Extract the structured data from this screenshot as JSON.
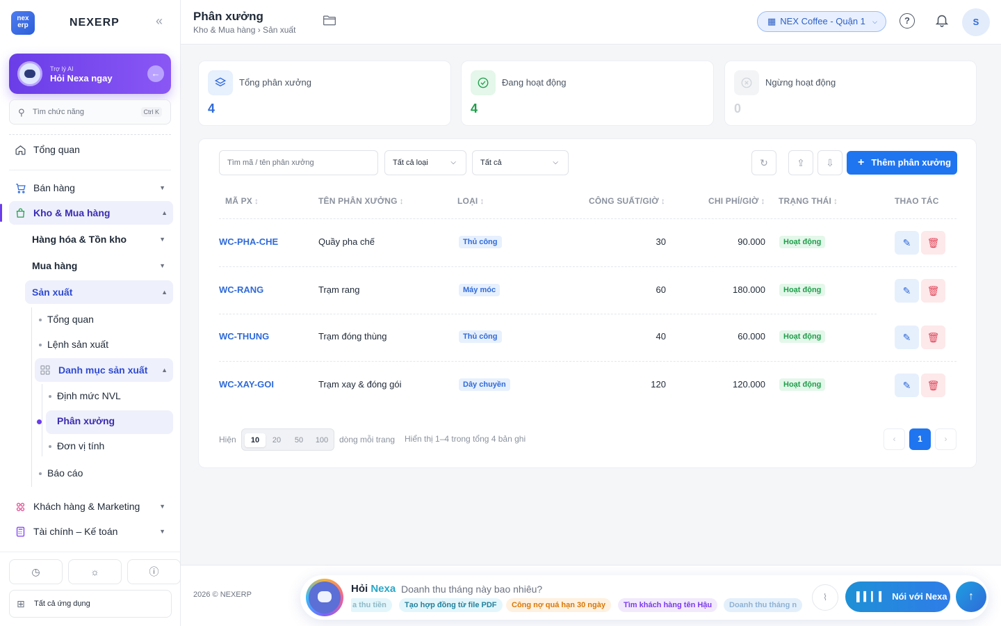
{
  "brand": {
    "logo_text": "nex erp",
    "name": "NEXERP",
    "collapse_icon": "double-chevron-left-icon"
  },
  "ai_card": {
    "small": "Trợ lý AI",
    "title": "Hỏi Nexa ngay"
  },
  "side_search": {
    "placeholder": "Tìm chức năng",
    "shortcut": "Ctrl K"
  },
  "nav": {
    "overview": "Tổng quan",
    "sales": "Bán hàng",
    "warehouse": "Kho & Mua hàng",
    "goods": "Hàng hóa & Tồn kho",
    "purchase": "Mua hàng",
    "production": "Sản xuất",
    "prod_overview": "Tổng quan",
    "prod_orders": "Lệnh sản xuất",
    "catalog": "Danh mục sản xuất",
    "bom": "Định mức NVL",
    "workshop": "Phân xưởng",
    "units": "Đơn vị tính",
    "reports": "Báo cáo",
    "customers": "Khách hàng & Marketing",
    "finance": "Tài chính – Kế toán"
  },
  "all_apps": "Tất cả ứng dụng",
  "header": {
    "title": "Phân xưởng",
    "breadcrumb": "Kho & Mua hàng › Sản xuất",
    "store": "NEX Coffee - Quận 1",
    "avatar": "S"
  },
  "stats": [
    {
      "label": "Tổng phân xưởng",
      "value": "4",
      "color": "#2f6ad9"
    },
    {
      "label": "Đang hoạt động",
      "value": "4",
      "color": "#1e9e4a"
    },
    {
      "label": "Ngừng hoạt động",
      "value": "0",
      "color": "#d1d5db"
    }
  ],
  "filters": {
    "search_placeholder": "Tìm mã / tên phân xưởng",
    "type": "Tất cả loại",
    "status": "Tất cả"
  },
  "add_button": "Thêm phân xưởng",
  "table": {
    "headers": {
      "code": "MÃ PX",
      "name": "TÊN PHÂN XƯỞNG",
      "type": "LOẠI",
      "capacity": "CÔNG SUẤT/GIỜ",
      "cost": "CHI PHÍ/GIỜ",
      "status": "TRẠNG THÁI",
      "actions": "THAO TÁC"
    },
    "rows": [
      {
        "code": "WC-PHA-CHE",
        "name": "Quầy pha chế",
        "type": "Thủ công",
        "capacity": "30",
        "cost": "90.000",
        "status": "Hoạt động"
      },
      {
        "code": "WC-RANG",
        "name": "Trạm rang",
        "type": "Máy móc",
        "capacity": "60",
        "cost": "180.000",
        "status": "Hoạt động"
      },
      {
        "code": "WC-THUNG",
        "name": "Trạm đóng thùng",
        "type": "Thủ công",
        "capacity": "40",
        "cost": "60.000",
        "status": "Hoạt động"
      },
      {
        "code": "WC-XAY-GOI",
        "name": "Trạm xay & đóng gói",
        "type": "Dây chuyền",
        "capacity": "120",
        "cost": "120.000",
        "status": "Hoạt động"
      }
    ]
  },
  "pager": {
    "show": "Hiện",
    "sizes": [
      "10",
      "20",
      "50",
      "100"
    ],
    "per_page": "dòng mỗi trang",
    "info": "Hiển thị 1–4 trong tổng 4 bản ghi",
    "current": "1"
  },
  "footer": {
    "copyright": "2026 © NEXERP"
  },
  "ask": {
    "title_a": "Hỏi",
    "title_b": "Nexa",
    "question": "Doanh thu tháng này bao nhiêu?",
    "chips": [
      "a thu tiền",
      "Tạo hợp đồng từ file PDF",
      "Công nợ quá hạn 30 ngày",
      "Tìm khách hàng tên Hậu",
      "Doanh thu tháng n"
    ],
    "talk": "Nói với Nexa"
  }
}
